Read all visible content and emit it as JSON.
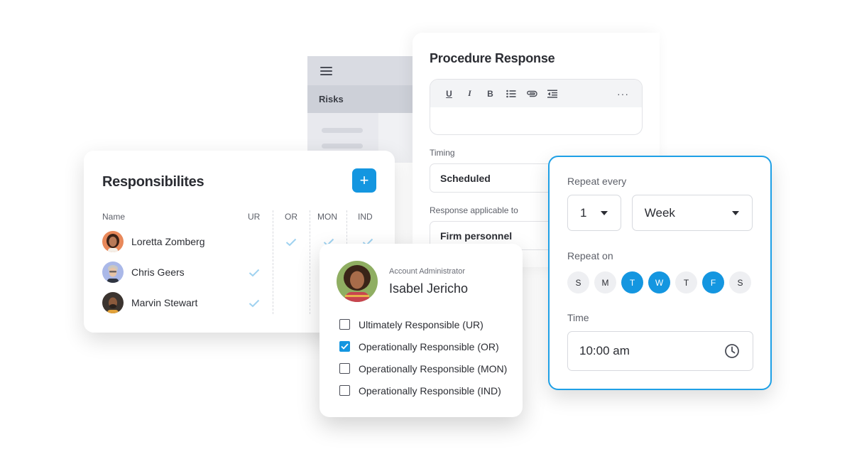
{
  "risks_panel": {
    "item_label": "Risks"
  },
  "procedure": {
    "title": "Procedure Response",
    "toolbar": {
      "underline": "U",
      "italic": "I",
      "bold": "B",
      "more": "···"
    },
    "timing_label": "Timing",
    "timing_value": "Scheduled",
    "applicable_label": "Response applicable to",
    "applicable_value": "Firm personnel"
  },
  "responsibilities": {
    "title": "Responsibilites",
    "add_label": "+",
    "columns": [
      "Name",
      "UR",
      "OR",
      "MON",
      "IND"
    ],
    "people": [
      {
        "name": "Loretta Zomberg",
        "checks": {
          "UR": false,
          "OR": true,
          "MON": true,
          "IND": true
        }
      },
      {
        "name": "Chris Geers",
        "checks": {
          "UR": true,
          "OR": false,
          "MON": false,
          "IND": false
        }
      },
      {
        "name": "Marvin Stewart",
        "checks": {
          "UR": true,
          "OR": false,
          "MON": false,
          "IND": false
        }
      }
    ]
  },
  "admin": {
    "role": "Account Administrator",
    "name": "Isabel Jericho",
    "options": [
      {
        "label": "Ultimately Responsible (UR)",
        "checked": false
      },
      {
        "label": "Operationally Responsible (OR)",
        "checked": true
      },
      {
        "label": "Operationally Responsible (MON)",
        "checked": false
      },
      {
        "label": "Operationally Responsible (IND)",
        "checked": false
      }
    ]
  },
  "repeat": {
    "every_label": "Repeat every",
    "count_value": "1",
    "unit_value": "Week",
    "on_label": "Repeat on",
    "days": [
      {
        "label": "S",
        "active": false
      },
      {
        "label": "M",
        "active": false
      },
      {
        "label": "T",
        "active": true
      },
      {
        "label": "W",
        "active": true
      },
      {
        "label": "T",
        "active": false
      },
      {
        "label": "F",
        "active": true
      },
      {
        "label": "S",
        "active": false
      }
    ],
    "time_label": "Time",
    "time_value": "10:00 am"
  },
  "colors": {
    "accent": "#1496e0",
    "check": "#9fd2f0",
    "border_focus": "#1ea0e6"
  },
  "icons": [
    "menu-icon",
    "underline-icon",
    "italic-icon",
    "bold-icon",
    "list-icon",
    "attach-icon",
    "indent-icon",
    "more-icon",
    "plus-icon",
    "checkmark-icon",
    "chevron-down-icon",
    "clock-icon"
  ]
}
